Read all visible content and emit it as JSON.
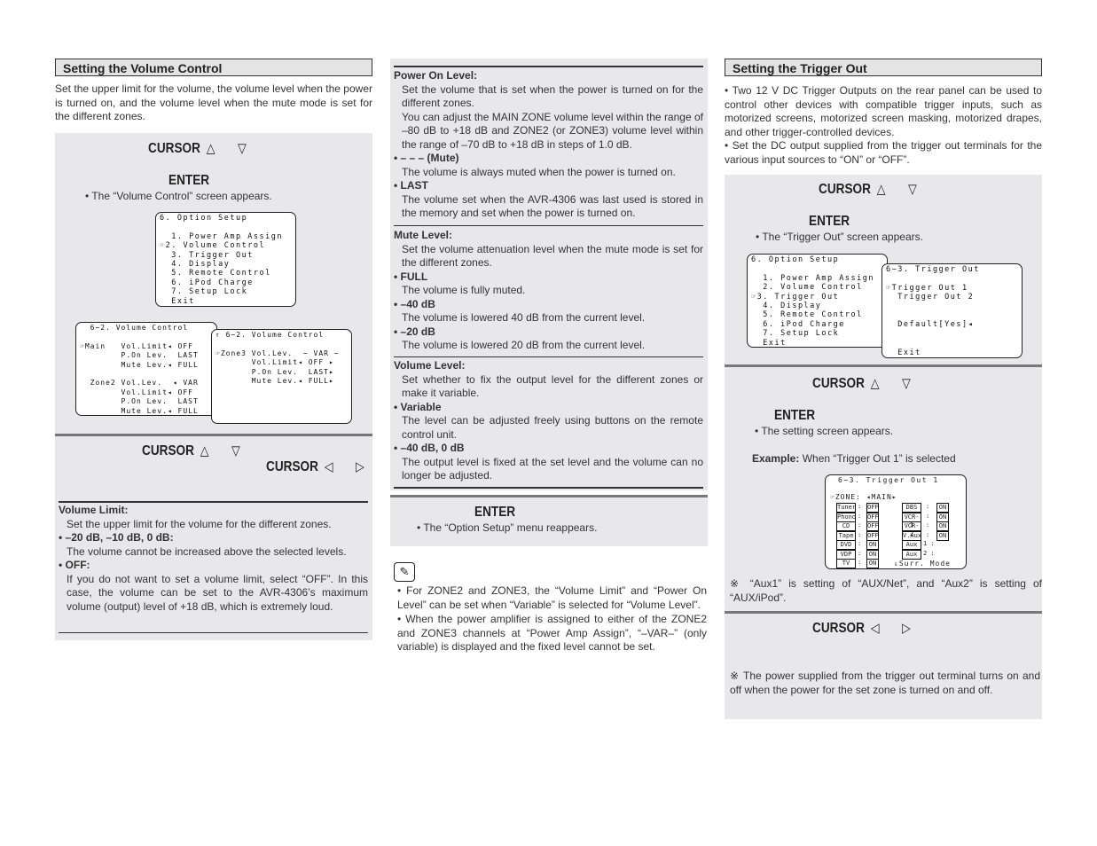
{
  "left": {
    "title": "Setting the Volume Control",
    "intro": "Set the upper limit for the volume, the volume level when the power is turned on, and the volume level when the mute mode is set for the different zones.",
    "step1_cursor": "CURSOR",
    "up": "△",
    "down": "▽",
    "left_arrow": "◁",
    "right_arrow": "▷",
    "step1_enter": "ENTER",
    "step1_note": "• The “Volume Control” screen appears.",
    "screen_option": "6. Option Setup\n\n  1. Power Amp Assign\n☞2. Volume Control\n  3. Trigger Out\n  4. Display\n  5. Remote Control\n  6. iPod Charge\n  7. Setup Lock\n  Exit",
    "screen_vol1": "  6−2. Volume Control\n\n☞Main   Vol.Limit◂ OFF\n        P.On Lev.  LAST\n        Mute Lev.◂ FULL\n\n  Zone2 Vol.Lev.  ◂ VAR\n        Vol.Limit◂ OFF\n        P.On Lev.  LAST\n        Mute Lev.◂ FULL",
    "screen_vol2": "⇑ 6−2. Volume Control\n\n☞Zone3 Vol.Lev.  − VAR −\n       Vol.Limit◂ OFF ▸\n       P.On Lev.  LAST▸\n       Mute Lev.◂ FULL▸",
    "step2_cursor": "CURSOR",
    "step2_cursor2": "CURSOR",
    "vol_limit_head": "Volume Limit:",
    "vol_limit_desc": "Set the upper limit for the volume for the different zones.",
    "opt1_head": "• –20 dB, –10 dB, 0 dB:",
    "opt1_desc": "The volume cannot be increased above the selected levels.",
    "opt2_head": "• OFF:",
    "opt2_desc": "If you do not want to set a volume limit, select “OFF”. In this case, the volume can be set to the AVR-4306’s maximum volume (output) level of +18 dB, which is extremely loud."
  },
  "middle": {
    "pol_head": "Power On Level:",
    "pol_desc": "Set the volume that is set when the power is turned on for the different zones.",
    "pol_desc2": "You can adjust the MAIN ZONE volume level within the range of –80 dB to +18 dB and ZONE2 (or ZONE3) volume level within the range of –70 dB to +18 dB in steps of 1.0 dB.",
    "mute_opt_head": "• – – – (Mute)",
    "mute_opt_desc": "The volume is always muted when the power is turned on.",
    "last_head": "• LAST",
    "last_desc": "The volume set when the AVR-4306 was last used is stored in the memory and set when the power is turned on.",
    "ml_head": "Mute Level:",
    "ml_desc": "Set the volume attenuation level when the mute mode is set for the different zones.",
    "full_head": "• FULL",
    "full_desc": "The volume is fully muted.",
    "m40_head": "• –40 dB",
    "m40_desc": "The volume is lowered 40 dB from the current level.",
    "m20_head": "• –20 dB",
    "m20_desc": "The volume is lowered 20 dB from the current level.",
    "vl_head": "Volume Level:",
    "vl_desc": "Set whether to fix the output level for the different zones or make it variable.",
    "var_head": "• Variable",
    "var_desc": "The level can be adjusted freely using buttons on the remote control unit.",
    "fix_head": "• –40 dB, 0 dB",
    "fix_desc": "The output level is fixed at the set level and the volume can no longer be adjusted.",
    "enter": "ENTER",
    "enter_note": "• The “Option Setup” menu reappears.",
    "note_icon": "pencil-icon",
    "note1": "• For ZONE2 and ZONE3, the “Volume Limit” and “Power On Level” can be set when “Variable” is selected for “Volume Level”.",
    "note2": "• When the power amplifier is assigned to either of the ZONE2 and ZONE3 channels at “Power Amp Assign”, “–VAR–” (only variable) is displayed and the fixed level cannot be set."
  },
  "right": {
    "title": "Setting the Trigger Out",
    "bullet1": "• Two 12 V DC Trigger Outputs on the rear panel can be used to control other devices with compatible trigger inputs, such as motorized screens, motorized screen masking, motorized drapes, and other trigger-controlled devices.",
    "bullet2": "• Set the DC output supplied from the trigger out terminals for the various input sources to “ON” or “OFF”.",
    "cursor": "CURSOR",
    "enter": "ENTER",
    "step1_note": "• The “Trigger Out” screen appears.",
    "screen_option": "6. Option Setup\n\n  1. Power Amp Assign\n  2. Volume Control\n☞3. Trigger Out\n  4. Display\n  5. Remote Control\n  6. iPod Charge\n  7. Setup Lock\n  Exit",
    "screen_trig": "6−3. Trigger Out\n\n☞Trigger Out 1\n  Trigger Out 2\n\n\n  Default[Yes]◂\n\n\n  Exit",
    "step2_note": "• The setting screen appears.",
    "example_label": "Example:",
    "example_text": "When “Trigger Out 1” is selected",
    "ex_title": "6−3. Trigger Out 1",
    "ex_zone": "☞ZONE: ◂MAIN▸",
    "ex_left": [
      [
        "Tuner",
        "OFF"
      ],
      [
        "Phono",
        "OFF"
      ],
      [
        "CD",
        "OFF"
      ],
      [
        "Tape",
        "OFF"
      ],
      [
        "DVD",
        "ON"
      ],
      [
        "VDP",
        "ON"
      ],
      [
        "TV",
        "ON"
      ]
    ],
    "ex_right": [
      [
        "DBS",
        "ON"
      ],
      [
        "VCR-1",
        "ON"
      ],
      [
        "VCR-2",
        "ON"
      ],
      [
        "V.Aux",
        "ON"
      ],
      [
        "Aux",
        "1 :"
      ],
      [
        "Aux",
        "2 :"
      ]
    ],
    "ex_surr": "⇓Surr. Mode",
    "aux_note": "※ “Aux1” is setting of “AUX/Net”, and “Aux2” is setting of “AUX/iPod”.",
    "power_note": "※ The power supplied from the trigger out terminal turns on and off when the power for the set zone is turned on and off."
  }
}
